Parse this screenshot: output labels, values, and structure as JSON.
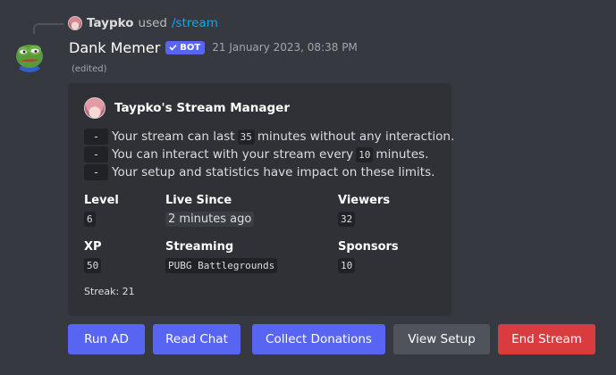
{
  "reply": {
    "username": "Taypko",
    "used_text": "used",
    "command": "/stream"
  },
  "message": {
    "author": "Dank Memer",
    "bot_tag": "BOT",
    "timestamp": "21 January 2023, 08:38 PM",
    "edited": "(edited)"
  },
  "embed": {
    "author_name": "Taypko's Stream Manager",
    "description": [
      {
        "dash": "-",
        "before": "Your stream can last",
        "code": "35",
        "after": "minutes without any interaction."
      },
      {
        "dash": "-",
        "before": "You can interact with your stream every",
        "code": "10",
        "after": "minutes."
      },
      {
        "dash": "-",
        "before": "Your setup and statistics have impact on these limits.",
        "code": "",
        "after": ""
      }
    ],
    "fields": {
      "level": {
        "name": "Level",
        "value": "6"
      },
      "live_since": {
        "name": "Live Since",
        "value": "2 minutes ago"
      },
      "viewers": {
        "name": "Viewers",
        "value": "32"
      },
      "xp": {
        "name": "XP",
        "value": "50"
      },
      "streaming": {
        "name": "Streaming",
        "value": "PUBG Battlegrounds"
      },
      "sponsors": {
        "name": "Sponsors",
        "value": "10"
      }
    },
    "streak": "Streak: 21"
  },
  "buttons": {
    "run_ad": "Run AD",
    "read_chat": "Read Chat",
    "collect_donations": "Collect Donations",
    "view_setup": "View Setup",
    "end_stream": "End Stream"
  },
  "colors": {
    "background": "#36393f",
    "embed_bg": "#2f3136",
    "blurple": "#5865f2",
    "secondary": "#4f545c",
    "danger": "#d83c3e",
    "link": "#00aff4"
  }
}
